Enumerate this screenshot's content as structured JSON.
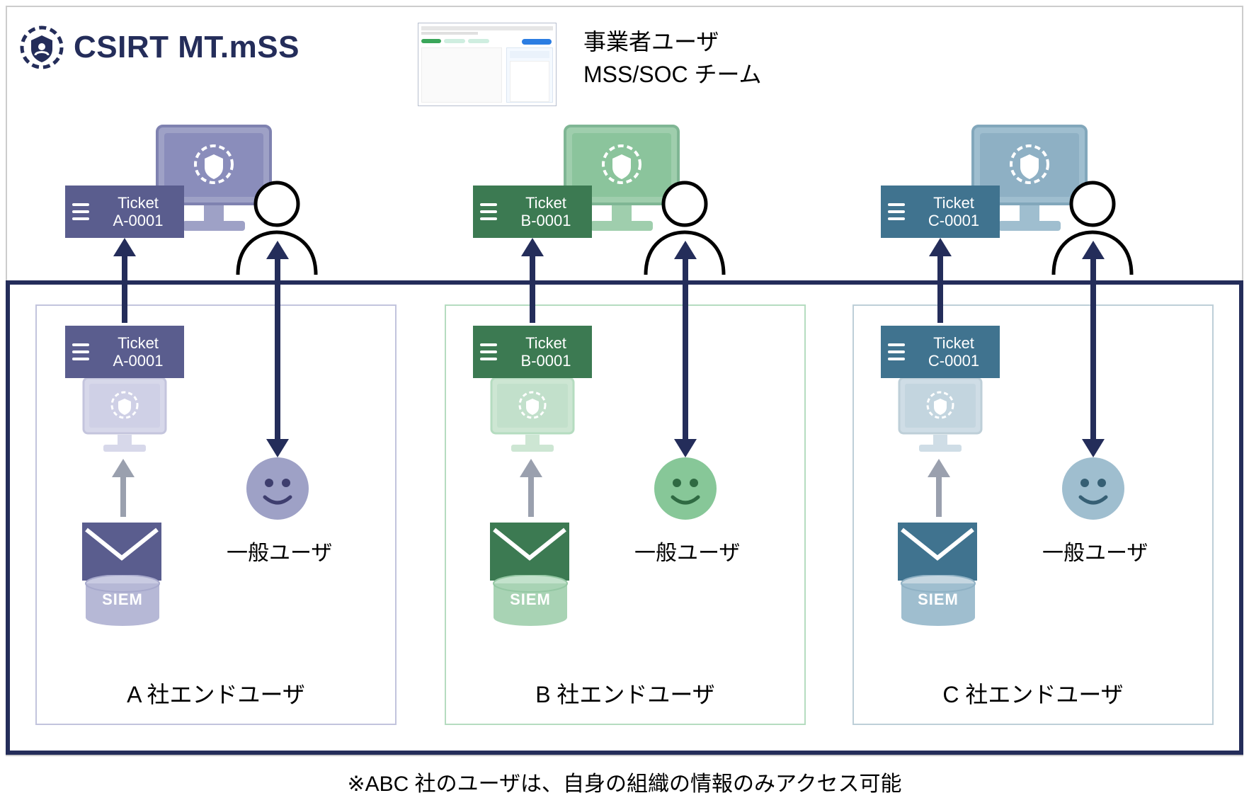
{
  "product": {
    "name": "CSIRT MT.mSS"
  },
  "header": {
    "caption_line1": "事業者ユーザ",
    "caption_line2": "MSS/SOC チーム"
  },
  "tickets": {
    "label": "Ticket",
    "a": "A-0001",
    "b": "B-0001",
    "c": "C-0001"
  },
  "labels": {
    "siem": "SIEM",
    "general_user": "一般ユーザ",
    "col_a": "A 社エンドユーザ",
    "col_b": "B 社エンドユーザ",
    "col_c": "C 社エンドユーザ"
  },
  "footnote": "※ABC 社のユーザは、自身の組織の情報のみアクセス可能",
  "colors": {
    "a_dark": "#5a5d8e",
    "a_light": "#b6b8d6",
    "b_dark": "#3c7a52",
    "b_light": "#a8d3b4",
    "c_dark": "#40738f",
    "c_light": "#9fbecf",
    "navy": "#242d5a"
  }
}
